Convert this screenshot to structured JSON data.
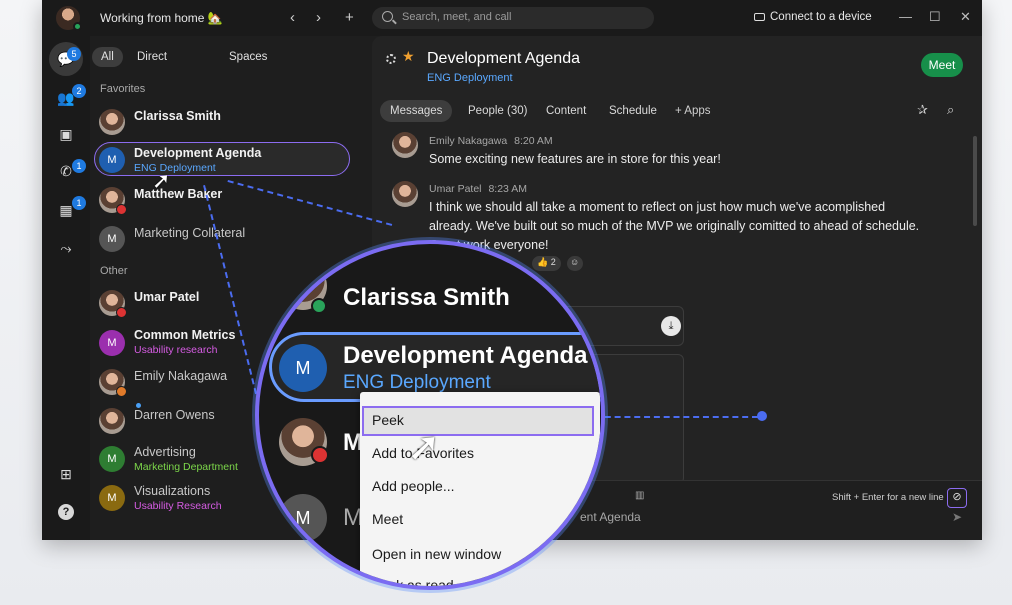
{
  "titlebar": {
    "status": "Working from home 🏡",
    "search_placeholder": "Search, meet, and call",
    "connect_label": "Connect to a device"
  },
  "rail": {
    "badges": {
      "messaging": "5",
      "teams": "2",
      "calls": "1",
      "calendar": "1"
    }
  },
  "filters": {
    "all": "All",
    "direct": "Direct",
    "spaces": "Spaces"
  },
  "sections": {
    "favorites": "Favorites",
    "other": "Other"
  },
  "spaces": {
    "clarissa": {
      "name": "Clarissa Smith"
    },
    "dev": {
      "name": "Development Agenda",
      "initial": "M",
      "sub": "ENG Deployment"
    },
    "matthew": {
      "name": "Matthew Baker"
    },
    "marketing": {
      "name": "Marketing Collateral",
      "initial": "M"
    },
    "umar": {
      "name": "Umar Patel"
    },
    "common": {
      "name": "Common Metrics",
      "initial": "M",
      "sub": "Usability research"
    },
    "emily": {
      "name": "Emily Nakagawa"
    },
    "darren": {
      "name": "Darren Owens"
    },
    "advertising": {
      "name": "Advertising",
      "initial": "M",
      "sub": "Marketing Department"
    },
    "visualizations": {
      "name": "Visualizations",
      "initial": "M",
      "sub": "Usability Research"
    }
  },
  "colors": {
    "accent_blue": "#5aa8ff",
    "meet_green": "#178f4a",
    "selection_purple": "#8c6cf0",
    "dev_avatar": "#1f5fb0",
    "common_avatar": "#9b2fae",
    "advertising_avatar": "#2e7d32",
    "visualizations_avatar": "#8a6a10",
    "common_sub": "#d65ce3",
    "advertising_sub": "#7cd64a",
    "visualizations_sub": "#d65ce3"
  },
  "header": {
    "title": "Development Agenda",
    "subtitle": "ENG Deployment",
    "meet_button": "Meet"
  },
  "tabs": {
    "messages": "Messages",
    "people": "People (30)",
    "content": "Content",
    "schedule": "Schedule",
    "apps": "+ Apps"
  },
  "messages": [
    {
      "author": "Emily Nakagawa",
      "time": "8:20 AM",
      "text": "Some exciting new features are in store for this year!"
    },
    {
      "author": "Umar Patel",
      "time": "8:23 AM",
      "line1": "I think we should all take a moment to reflect on just how much we've acomplished",
      "line2": "already. We've built out so much of the MVP we originally comitted to ahead of schedule.",
      "line3": "Great work everyone!"
    }
  ],
  "reactions": {
    "count": "👍 2"
  },
  "compose": {
    "hint": "Shift + Enter for a new line",
    "partial_placeholder": "ent Agenda"
  },
  "magnifier": {
    "top_name": "Clarissa Smith",
    "selected_title": "Development Agenda",
    "selected_sub": "ENG Deployment",
    "selected_initial": "M",
    "third_initial": "M",
    "fourth_initial": "M",
    "fourth_partial": "M",
    "third_partial": "M"
  },
  "context_menu": {
    "items": [
      "Peek",
      "Add to Favorites",
      "Add people...",
      "Meet",
      "Open in new window",
      "Mark as read"
    ]
  }
}
